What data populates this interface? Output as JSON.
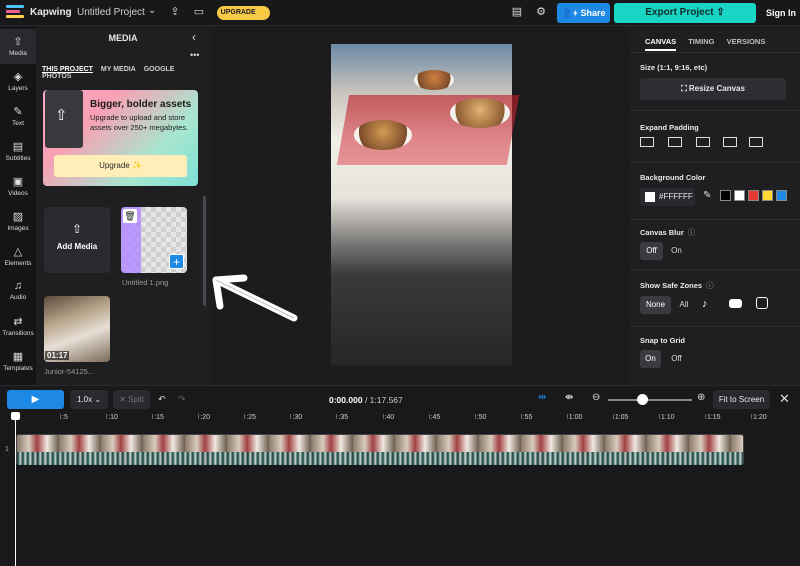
{
  "topbar": {
    "brand": "Kapwing",
    "separator": "›",
    "project_name": "Untitled Project",
    "upgrade_label": "UPGRADE ⚡",
    "share_label": "Share",
    "export_label": "Export Project",
    "signin_label": "Sign In",
    "colors": {
      "upgrade": "#f7c948",
      "share": "#1e88e5",
      "export": "#18d6c3"
    }
  },
  "leftnav": {
    "items": [
      {
        "label": "Media",
        "icon": "upload-icon"
      },
      {
        "label": "Layers",
        "icon": "layers-icon"
      },
      {
        "label": "Text",
        "icon": "text-icon"
      },
      {
        "label": "Subtitles",
        "icon": "subtitles-icon"
      },
      {
        "label": "Videos",
        "icon": "video-icon"
      },
      {
        "label": "Images",
        "icon": "image-icon"
      },
      {
        "label": "Elements",
        "icon": "elements-icon"
      },
      {
        "label": "Audio",
        "icon": "music-icon"
      },
      {
        "label": "Transitions",
        "icon": "transitions-icon"
      },
      {
        "label": "Templates",
        "icon": "templates-icon"
      }
    ]
  },
  "media": {
    "title": "MEDIA",
    "tabs": [
      "THIS PROJECT",
      "MY MEDIA",
      "GOOGLE PHOTOS"
    ],
    "promo": {
      "heading": "Bigger, bolder assets",
      "body": "Upgrade to upload and store assets over 250+ megabytes.",
      "button": "Upgrade ✨"
    },
    "add_media_label": "Add Media",
    "assets": [
      {
        "name": "Untitled 1.png"
      },
      {
        "name": "Junior-54125...",
        "duration": "01:17"
      }
    ]
  },
  "right_panel": {
    "tabs": [
      "CANVAS",
      "TIMING",
      "VERSIONS"
    ],
    "size_label": "Size (1:1, 9:16, etc)",
    "resize_label": "Resize Canvas",
    "expand_padding_label": "Expand Padding",
    "background_color_label": "Background Color",
    "background_color_value": "#FFFFFF",
    "swatches": [
      "#000000",
      "#ffffff",
      "#e53935",
      "#fdd835",
      "#1e88e5"
    ],
    "canvas_blur_label": "Canvas Blur",
    "canvas_blur_options": [
      "Off",
      "On"
    ],
    "safe_zones_label": "Show Safe Zones",
    "safe_zones_options": [
      "None",
      "All"
    ],
    "snap_label": "Snap to Grid",
    "snap_options": [
      "On",
      "Off"
    ]
  },
  "timeline": {
    "speed": "1.0x",
    "split_label": "✕ Split",
    "current_time": "0:00.000",
    "total_time": "/ 1:17.567",
    "fit_label": "Fit to Screen",
    "zoom_level": 0.4,
    "ruler_ticks": [
      "0",
      ":5",
      ":10",
      ":15",
      ":20",
      ":25",
      ":30",
      ":35",
      ":40",
      ":45",
      ":50",
      ":55",
      "1:00",
      "1:05",
      "1:10",
      "1:15",
      "1:20"
    ],
    "track_number": "1"
  }
}
